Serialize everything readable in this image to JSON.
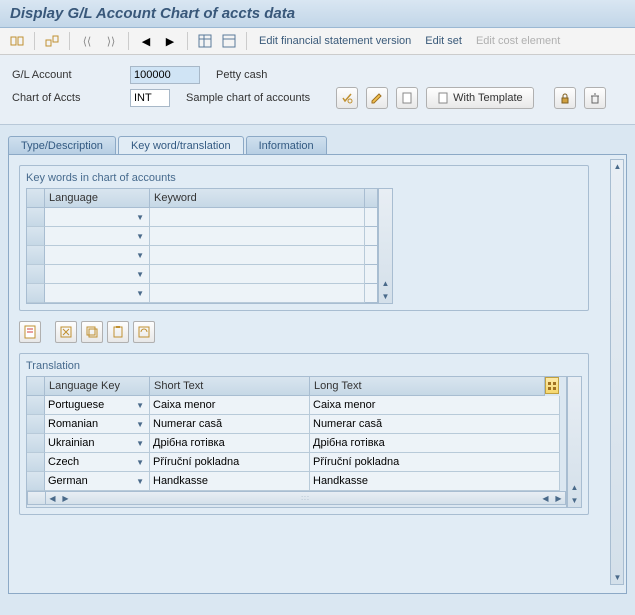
{
  "title": "Display G/L Account Chart of accts data",
  "toolbar_links": {
    "edit_fsv": "Edit financial statement version",
    "edit_set": "Edit set",
    "edit_cost": "Edit cost element"
  },
  "fields": {
    "gl_account_label": "G/L Account",
    "gl_account_value": "100000",
    "gl_account_desc": "Petty cash",
    "chart_label": "Chart of Accts",
    "chart_value": "INT",
    "chart_desc": "Sample chart of accounts",
    "with_template": "With Template"
  },
  "tabs": {
    "type_desc": "Type/Description",
    "key_trans": "Key word/translation",
    "info": "Information"
  },
  "group1": {
    "title": "Key words in chart of accounts",
    "col_lang": "Language",
    "col_keyword": "Keyword"
  },
  "group2": {
    "title": "Translation",
    "col_langkey": "Language Key",
    "col_short": "Short Text",
    "col_long": "Long Text",
    "rows": [
      {
        "lang": "Portuguese",
        "short": "Caixa menor",
        "long": "Caixa menor"
      },
      {
        "lang": "Romanian",
        "short": "Numerar casă",
        "long": "Numerar casă"
      },
      {
        "lang": "Ukrainian",
        "short": "Дрібна готівка",
        "long": "Дрібна готівка"
      },
      {
        "lang": "Czech",
        "short": "Příruční pokladna",
        "long": "Příruční pokladna"
      },
      {
        "lang": "German",
        "short": "Handkasse",
        "long": "Handkasse"
      }
    ]
  }
}
